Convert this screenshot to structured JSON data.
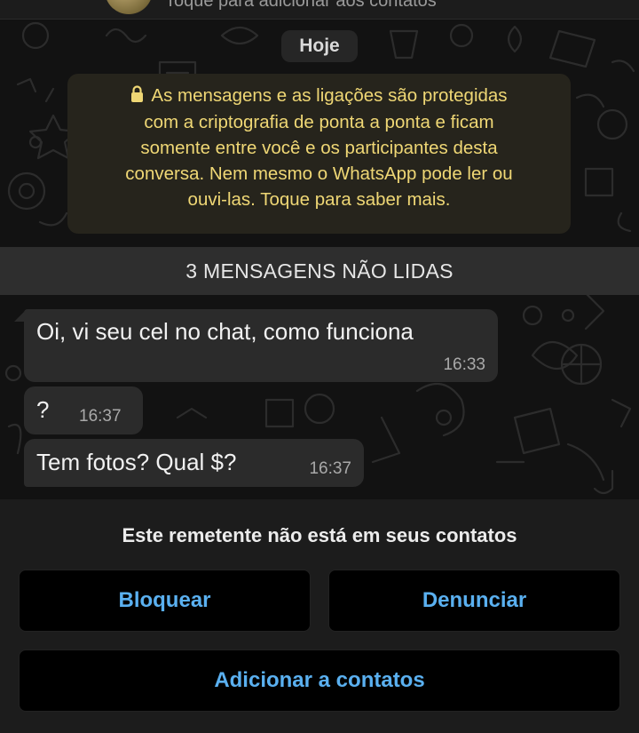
{
  "header": {
    "subtitle": "Toque para adicionar aos contatos"
  },
  "chat": {
    "date_label": "Hoje",
    "encryption_notice": {
      "lines": [
        "As mensagens e as ligações são protegidas",
        "com a criptografia de ponta a ponta e ficam",
        "somente entre você e os participantes desta",
        "conversa. Nem mesmo o WhatsApp pode ler ou",
        "ouvi-las. Toque para saber mais."
      ],
      "color": "#efd775"
    },
    "unread_banner": "3 MENSAGENS NÃO LIDAS",
    "messages": [
      {
        "text": "Oi, vi seu cel no chat, como funciona",
        "time": "16:33"
      },
      {
        "text": "?",
        "time": "16:37"
      },
      {
        "text": "Tem fotos? Qual $?",
        "time": "16:37"
      }
    ]
  },
  "sender_panel": {
    "notice": "Este remetente não está em seus contatos",
    "block_label": "Bloquear",
    "report_label": "Denunciar",
    "add_label": "Adicionar a contatos",
    "accent": "#5ab0f0"
  }
}
